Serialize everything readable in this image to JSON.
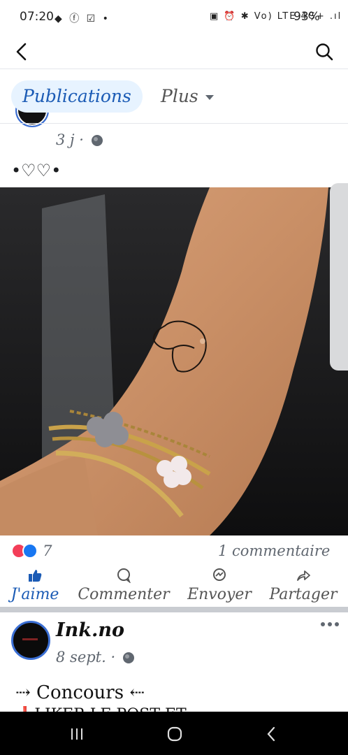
{
  "status": {
    "time": "07:20",
    "left_icons": "◆ ⓕ ☑ •",
    "right_icons": "▣ ⏰ ✱ Vo) LTE 4G+ .ıl",
    "battery": "93%"
  },
  "tabs": {
    "publications": "Publications",
    "plus": "Plus"
  },
  "post1": {
    "date": "3 j · ",
    "text": "•♡♡•",
    "reaction_count": "7",
    "comments": "1 commentaire"
  },
  "actions": {
    "like": "J'aime",
    "comment": "Commenter",
    "send": "Envoyer",
    "share": "Partager"
  },
  "post2": {
    "author": "Ink.no",
    "date": "8 sept. · ",
    "line1": "⇢ Concours ⇠",
    "line2_partial": "❗LIKER LE POST ET ..."
  },
  "colors": {
    "accent": "#1b5bb5",
    "tab_bg": "#e7f3ff",
    "love": "#f33e58",
    "like": "#1877f2"
  }
}
